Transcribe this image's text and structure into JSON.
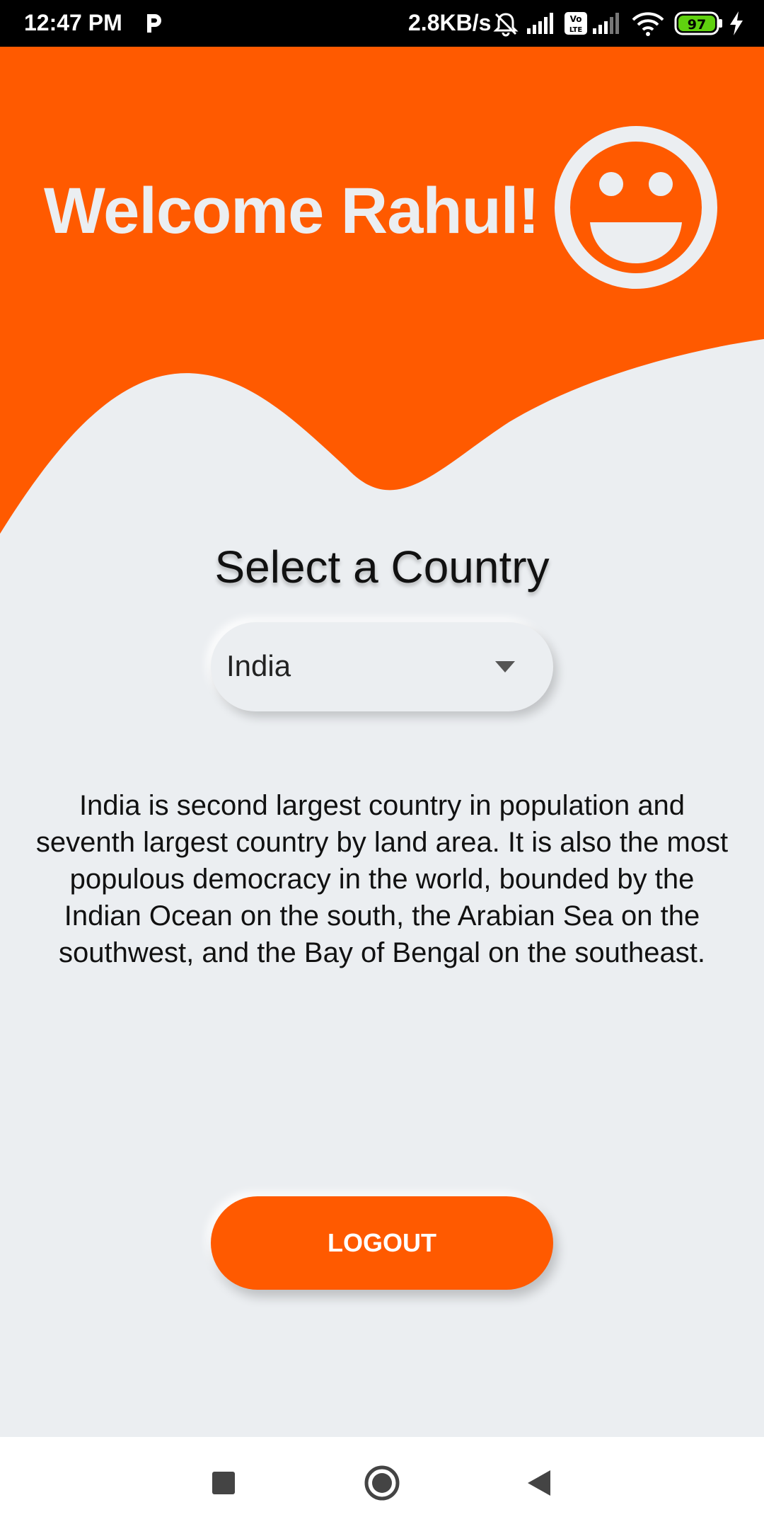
{
  "status_bar": {
    "time": "12:47 PM",
    "net_speed": "2.8KB/s",
    "battery_level": "97",
    "icons": [
      "p-app-icon",
      "alarm-off-icon",
      "signal-icon",
      "volte-icon",
      "signal-icon",
      "wifi-icon",
      "battery-icon",
      "charging-icon"
    ]
  },
  "header": {
    "welcome_text": "Welcome Rahul!",
    "avatar_icon": "smiley-face-icon",
    "accent_color": "#ff5a00"
  },
  "main": {
    "select_title": "Select a Country",
    "selected_country": "India",
    "description": "India is second largest country in population and seventh largest country by land area. It is also the most populous democracy in the world, bounded by the Indian Ocean on the south, the Arabian Sea on the southwest, and the Bay of Bengal on the southeast.",
    "logout_label": "LOGOUT"
  },
  "nav_bar": {
    "buttons": [
      "recents-square-icon",
      "home-circle-icon",
      "back-triangle-icon"
    ]
  }
}
